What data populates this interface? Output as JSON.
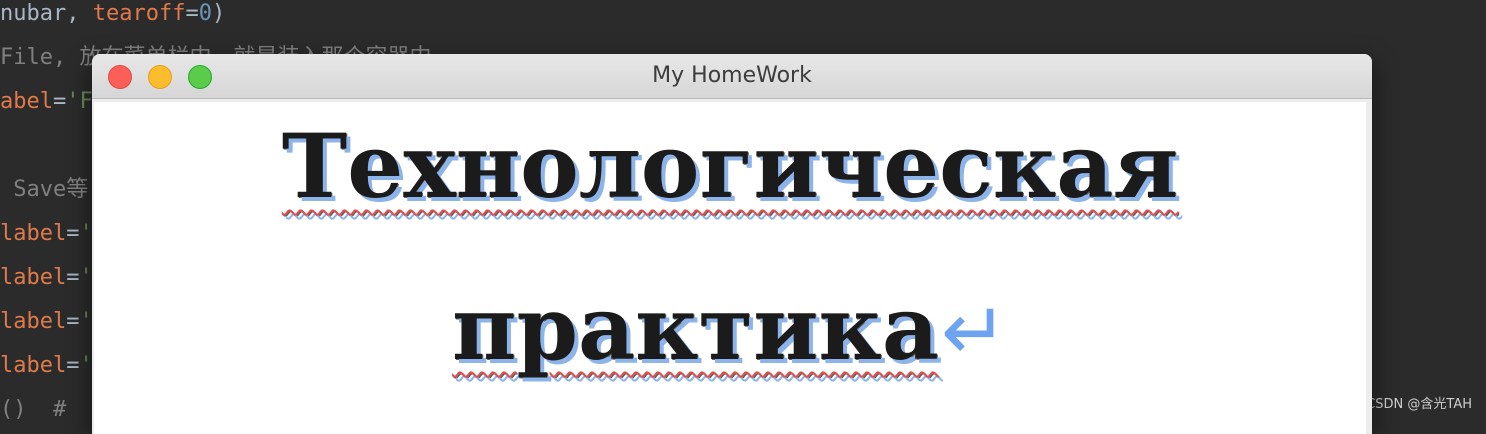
{
  "editor": {
    "lines": [
      [
        {
          "t": "nubar, ",
          "c": "default"
        },
        {
          "t": "tearoff",
          "c": "param"
        },
        {
          "t": "=",
          "c": "default"
        },
        {
          "t": "0",
          "c": "num"
        },
        {
          "t": ")",
          "c": "default"
        }
      ],
      [
        {
          "t": "File, 放在菜单栏中，就是装入那个容器中",
          "c": "comment"
        }
      ],
      [
        {
          "t": "abel",
          "c": "param"
        },
        {
          "t": "=",
          "c": "default"
        },
        {
          "t": "'F",
          "c": "str"
        }
      ],
      [],
      [
        {
          "t": " Save等",
          "c": "comment"
        }
      ],
      [
        {
          "t": "label",
          "c": "param"
        },
        {
          "t": "=",
          "c": "default"
        },
        {
          "t": "'",
          "c": "str"
        }
      ],
      [
        {
          "t": "label",
          "c": "param"
        },
        {
          "t": "=",
          "c": "default"
        },
        {
          "t": "'",
          "c": "str"
        }
      ],
      [
        {
          "t": "label",
          "c": "param"
        },
        {
          "t": "=",
          "c": "default"
        },
        {
          "t": "'",
          "c": "str"
        }
      ],
      [
        {
          "t": "label",
          "c": "param"
        },
        {
          "t": "=",
          "c": "default"
        },
        {
          "t": "'",
          "c": "str"
        }
      ],
      [
        {
          "t": "()  # ",
          "c": "comment"
        }
      ]
    ]
  },
  "window": {
    "title": "My HomeWork",
    "buttons": {
      "close": "close-button",
      "minimize": "minimize-button",
      "maximize": "maximize-button"
    }
  },
  "document": {
    "line1": "Технологическая",
    "line2": "практика",
    "paragraph_mark": "↵"
  },
  "watermark": "CSDN @含光TAH",
  "colors": {
    "editor_bg": "#2b2b2b",
    "keyword_param": "#e07a4a",
    "number": "#6897bb",
    "string": "#6a8759",
    "comment": "#808080",
    "title_bar": "#e0e0e0",
    "close": "#fc5f57",
    "minimize": "#fdbc2e",
    "maximize": "#5bcb4a",
    "text_shadow": "#8cb4ea",
    "spell_underline": "#e05050"
  }
}
